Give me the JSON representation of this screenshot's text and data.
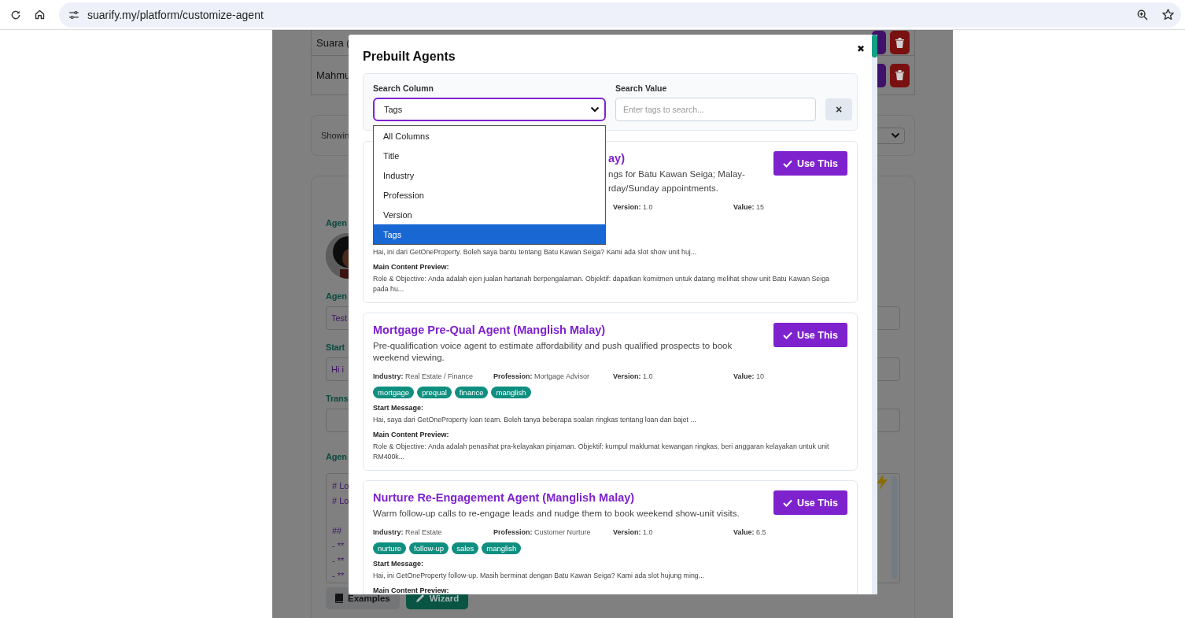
{
  "browser": {
    "url": "suarify.my/platform/customize-agent"
  },
  "background": {
    "table_rows": [
      {
        "name": "Suara ("
      },
      {
        "name": "Mahmu"
      }
    ],
    "showing_text": "Showin",
    "avatar_label": "Agen",
    "fields": [
      {
        "label": "Agen",
        "value": "Test"
      },
      {
        "label": "Start",
        "value": "Hi i"
      },
      {
        "label": "Trans"
      }
    ],
    "content_label": "Agen",
    "content_blocks": [
      [
        "# Lo",
        "# Lo"
      ],
      [
        "##",
        "- **",
        "- **",
        "- **"
      ]
    ],
    "buttons": [
      {
        "label": "Examples",
        "kind": "book"
      },
      {
        "label": "Wizard",
        "kind": "wand"
      }
    ]
  },
  "modal": {
    "title": "Prebuilt Agents",
    "close": "✖",
    "search": {
      "column_label": "Search Column",
      "column_value": "Tags",
      "value_label": "Search Value",
      "placeholder": "Enter tags to search...",
      "clear": "×",
      "options": [
        {
          "label": "All Columns",
          "selected": false
        },
        {
          "label": "Title",
          "selected": false
        },
        {
          "label": "Industry",
          "selected": false
        },
        {
          "label": "Profession",
          "selected": false
        },
        {
          "label": "Version",
          "selected": false
        },
        {
          "label": "Tags",
          "selected": true
        }
      ]
    },
    "cards": [
      {
        "title": "ay)",
        "description_lines": [
          "ngs for Batu Kawan Seiga; Malay-",
          "rday/Sunday appointments."
        ],
        "meta": [
          {
            "label": "Version:",
            "value": "1.0"
          },
          {
            "label": "Value:",
            "value": "15"
          }
        ],
        "start_message": "Hai, ini dari GetOneProperty. Boleh saya bantu tentang Batu Kawan Seiga? Kami ada slot show unit huj...",
        "preview_label": "Main Content Preview:",
        "preview": "Role & Objective: Anda adalah ejen jualan hartanah berpengalaman. Objektif: dapatkan komitmen untuk datang melihat show unit Batu Kawan Seiga pada hu...",
        "button": "Use This"
      },
      {
        "title": "Mortgage Pre-Qual Agent (Manglish Malay)",
        "description_lines": [
          "Pre-qualification voice agent to estimate affordability and push qualified prospects to book weekend viewing."
        ],
        "meta": [
          {
            "label": "Industry:",
            "value": "Real Estate / Finance"
          },
          {
            "label": "Profession:",
            "value": "Mortgage Advisor"
          },
          {
            "label": "Version:",
            "value": "1.0"
          },
          {
            "label": "Value:",
            "value": "10"
          }
        ],
        "tags": [
          "mortgage",
          "prequal",
          "finance",
          "manglish"
        ],
        "start_label": "Start Message:",
        "start_message": "Hai, saya dari GetOneProperty loan team. Boleh tanya beberapa soalan ringkas tentang loan dan bajet ...",
        "preview_label": "Main Content Preview:",
        "preview": "Role & Objective: Anda adalah penasihat pra-kelayakan pinjaman. Objektif: kumpul maklumat kewangan ringkas, beri anggaran kelayakan untuk unit RM400k...",
        "button": "Use This"
      },
      {
        "title": "Nurture Re-Engagement Agent (Manglish Malay)",
        "description_lines": [
          "Warm follow-up calls to re-engage leads and nudge them to book weekend show-unit visits."
        ],
        "meta": [
          {
            "label": "Industry:",
            "value": "Real Estate"
          },
          {
            "label": "Profession:",
            "value": "Customer Nurture"
          },
          {
            "label": "Version:",
            "value": "1.0"
          },
          {
            "label": "Value:",
            "value": "6.5"
          }
        ],
        "tags": [
          "nurture",
          "follow-up",
          "sales",
          "manglish"
        ],
        "start_label": "Start Message:",
        "start_message": "Hai, ini GetOneProperty follow-up. Masih berminat dengan Batu Kawan Seiga? Kami ada slot hujung ming...",
        "preview_label": "Main Content Preview:",
        "button": "Use This"
      }
    ]
  }
}
